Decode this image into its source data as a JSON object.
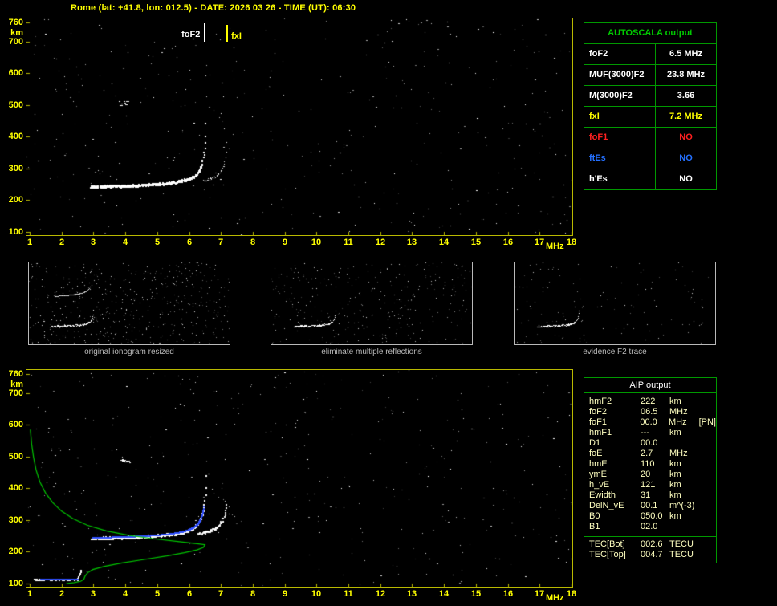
{
  "header": {
    "title": "Rome (lat: +41.8, lon: 012.5) - DATE: 2026 03 26 - TIME (UT): 06:30"
  },
  "plots": {
    "y_unit": "km",
    "x_unit": "MHz",
    "y_ticks": [
      "760",
      "700",
      "600",
      "500",
      "400",
      "300",
      "200",
      "100"
    ],
    "x_ticks": [
      "1",
      "2",
      "3",
      "4",
      "5",
      "6",
      "7",
      "8",
      "9",
      "10",
      "11",
      "12",
      "13",
      "14",
      "15",
      "16",
      "17",
      "18"
    ],
    "markers": [
      {
        "label": "foF2",
        "freq": 6.5,
        "color": "#ffffff"
      },
      {
        "label": "fxI",
        "freq": 7.2,
        "color": "#ffff00"
      }
    ]
  },
  "autoscala_table": {
    "title": "AUTOSCALA output",
    "rows": [
      {
        "param": "foF2",
        "value": "6.5 MHz",
        "color": "#ffffff"
      },
      {
        "param": "MUF(3000)F2",
        "value": "23.8 MHz",
        "color": "#ffffff"
      },
      {
        "param": "M(3000)F2",
        "value": "3.66",
        "color": "#ffffff"
      },
      {
        "param": "fxI",
        "value": "7.2 MHz",
        "color": "#ffff00"
      },
      {
        "param": "foF1",
        "value": "NO",
        "color": "#ff2020"
      },
      {
        "param": "ftEs",
        "value": "NO",
        "color": "#2470ff"
      },
      {
        "param": "h'Es",
        "value": "NO",
        "color": "#ffffff"
      }
    ]
  },
  "thumbnails": [
    {
      "caption": "original ionogram resized"
    },
    {
      "caption": "eliminate multiple reflections"
    },
    {
      "caption": "evidence F2 trace"
    }
  ],
  "aip_table": {
    "title": "AIP output",
    "rows": [
      {
        "param": "hmF2",
        "value": "222",
        "unit": "km",
        "note": ""
      },
      {
        "param": "foF2",
        "value": "06.5",
        "unit": "MHz",
        "note": ""
      },
      {
        "param": "foF1",
        "value": "00.0",
        "unit": "MHz",
        "note": "[PN]"
      },
      {
        "param": "hmF1",
        "value": "---",
        "unit": "km",
        "note": ""
      },
      {
        "param": "D1",
        "value": "00.0",
        "unit": "",
        "note": ""
      },
      {
        "param": "foE",
        "value": "2.7",
        "unit": "MHz",
        "note": ""
      },
      {
        "param": "hmE",
        "value": "110",
        "unit": "km",
        "note": ""
      },
      {
        "param": "ymE",
        "value": "20",
        "unit": "km",
        "note": ""
      },
      {
        "param": "h_vE",
        "value": "121",
        "unit": "km",
        "note": ""
      },
      {
        "param": "Ewidth",
        "value": "31",
        "unit": "km",
        "note": ""
      },
      {
        "param": "DelN_vE",
        "value": "00.1",
        "unit": "m^(-3)",
        "note": ""
      },
      {
        "param": "B0",
        "value": "050.0",
        "unit": "km",
        "note": ""
      },
      {
        "param": "B1",
        "value": "02.0",
        "unit": "",
        "note": ""
      }
    ],
    "tec_rows": [
      {
        "param": "TEC[Bot]",
        "value": "002.6",
        "unit": "TECU"
      },
      {
        "param": "TEC[Top]",
        "value": "004.7",
        "unit": "TECU"
      }
    ]
  },
  "ionogram": {
    "foF2_mhz": 6.5,
    "fxI_mhz": 7.2,
    "min_virtual_height_km": 240,
    "f_axis_range_mhz": [
      1,
      18
    ],
    "h_axis_range_km": [
      100,
      760
    ],
    "profile_points": [
      [
        1.02,
        585
      ],
      [
        1.06,
        540
      ],
      [
        1.12,
        498
      ],
      [
        1.2,
        458
      ],
      [
        1.32,
        420
      ],
      [
        1.5,
        385
      ],
      [
        1.72,
        355
      ],
      [
        2.0,
        328
      ],
      [
        2.35,
        305
      ],
      [
        2.8,
        284
      ],
      [
        3.4,
        266
      ],
      [
        4.1,
        252
      ],
      [
        4.9,
        241
      ],
      [
        5.7,
        232
      ],
      [
        6.3,
        225
      ],
      [
        6.5,
        222
      ],
      [
        6.45,
        214
      ],
      [
        6.25,
        206
      ],
      [
        5.85,
        197
      ],
      [
        5.3,
        187
      ],
      [
        4.6,
        176
      ],
      [
        3.9,
        165
      ],
      [
        3.35,
        154
      ],
      [
        2.98,
        144
      ],
      [
        2.82,
        134
      ],
      [
        2.74,
        124
      ],
      [
        2.7,
        114
      ],
      [
        2.6,
        107
      ],
      [
        2.4,
        103
      ],
      [
        2.15,
        100
      ]
    ]
  },
  "colors": {
    "axis_yellow": "#ffff00",
    "plot_border": "#b9b900",
    "table_border": "#009900",
    "autoscala_title_green": "#00cc00",
    "profile_green": "#00c800",
    "trace_blue": "#3050ff",
    "caption_gray": "#b9b9b9",
    "aip_text": "#ffffc0"
  }
}
